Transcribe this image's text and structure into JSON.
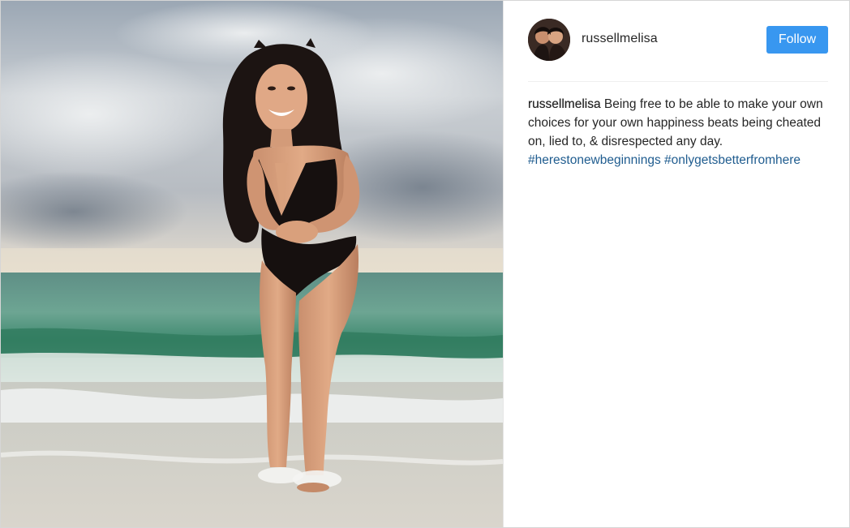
{
  "post": {
    "username": "russellmelisa",
    "follow_label": "Follow",
    "caption": {
      "username": "russellmelisa",
      "text": "Being free to be able to make your own choices for your own happiness beats being cheated on, lied to, & disrespected any day.",
      "hashtags": [
        "#herestonewbeginnings",
        "#onlygetsbetterfromhere"
      ]
    }
  },
  "colors": {
    "follow_button": "#3897f0",
    "hashtag": "#1f5c8f",
    "text": "#262626"
  },
  "icons": {
    "avatar": "profile-photo"
  }
}
